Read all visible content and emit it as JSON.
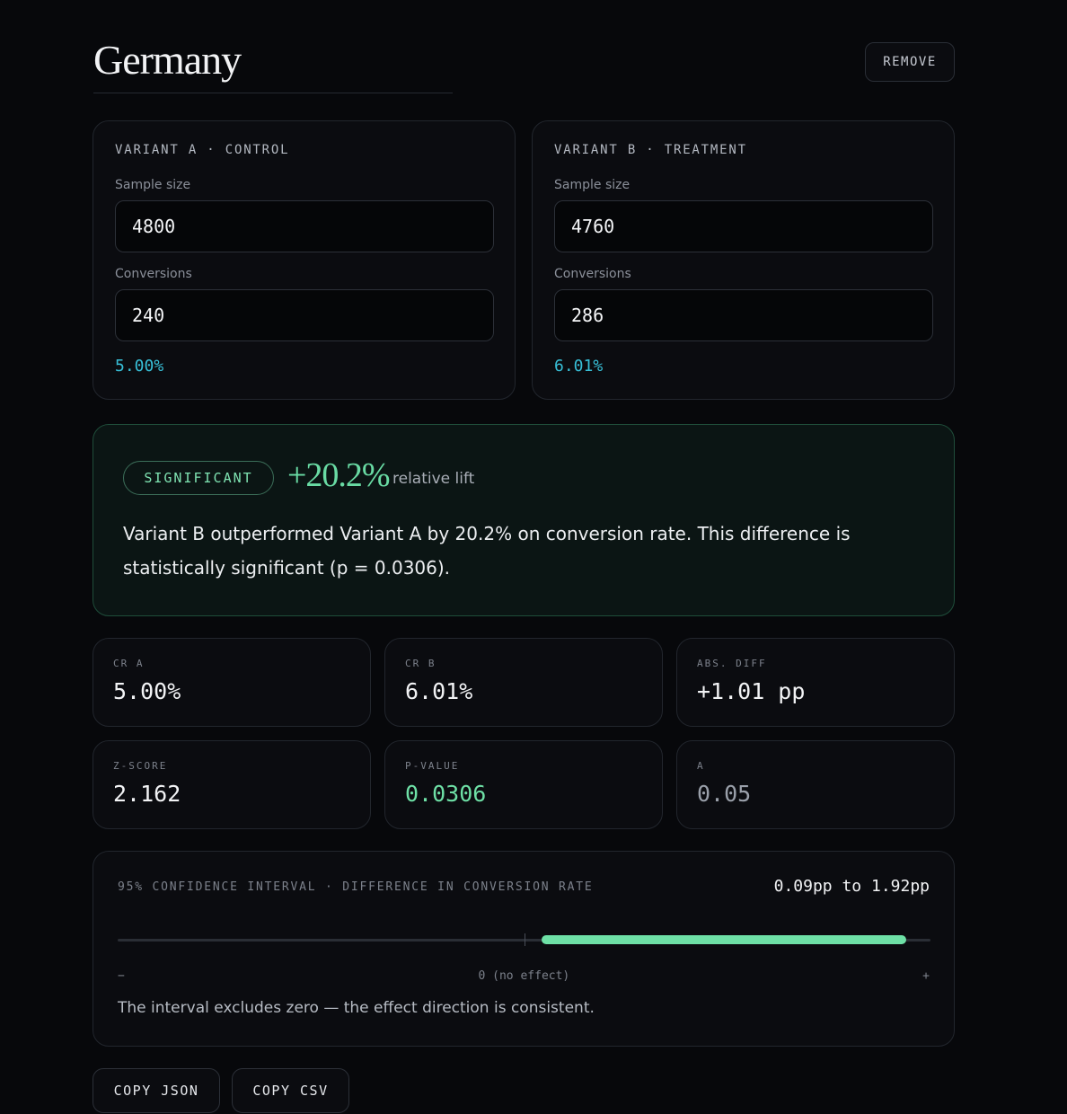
{
  "header": {
    "title": "Germany",
    "remove_label": "REMOVE"
  },
  "variant_a": {
    "label": "VARIANT A · CONTROL",
    "sample_size_label": "Sample size",
    "sample_size": "4800",
    "conversions_label": "Conversions",
    "conversions": "240",
    "rate": "5.00%"
  },
  "variant_b": {
    "label": "VARIANT B · TREATMENT",
    "sample_size_label": "Sample size",
    "sample_size": "4760",
    "conversions_label": "Conversions",
    "conversions": "286",
    "rate": "6.01%"
  },
  "result": {
    "badge": "SIGNIFICANT",
    "lift": "+20.2%",
    "lift_label": "relative lift",
    "summary": "Variant B outperformed Variant A by 20.2% on conversion rate. This difference is statistically significant (p = 0.0306)."
  },
  "stats": [
    {
      "label": "CR A",
      "value": "5.00%"
    },
    {
      "label": "CR B",
      "value": "6.01%"
    },
    {
      "label": "ABS. DIFF",
      "value": "+1.01 pp"
    },
    {
      "label": "Z-SCORE",
      "value": "2.162"
    },
    {
      "label": "P-VALUE",
      "value": "0.0306"
    },
    {
      "label": "Α",
      "value": "0.05"
    }
  ],
  "confidence": {
    "label": "95% CONFIDENCE INTERVAL · DIFFERENCE IN CONVERSION RATE",
    "range": "0.09pp to 1.92pp",
    "lower_pp": 0.09,
    "upper_pp": 1.92,
    "axis_min_pp": -2.04,
    "axis_max_pp": 2.04,
    "axis_left": "−",
    "axis_center": "0 (no effect)",
    "axis_right": "+",
    "note": "The interval excludes zero — the effect direction is consistent."
  },
  "actions": {
    "copy_json": "COPY JSON",
    "copy_csv": "COPY CSV"
  },
  "colors": {
    "accent_green": "#6ee0a6",
    "rate_cyan": "#38c0d8",
    "background": "#07080b"
  }
}
